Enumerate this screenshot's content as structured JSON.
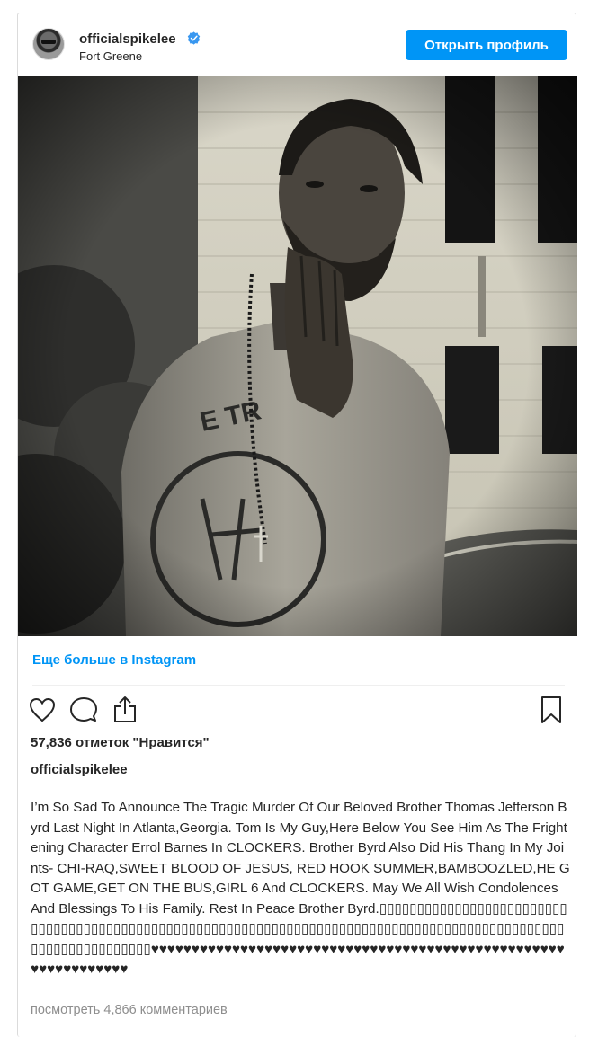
{
  "post": {
    "username": "officialspikelee",
    "location": "Fort Greene",
    "open_profile_label": "Открыть профиль",
    "more_link": "Еще больше в Instagram",
    "likes_text": "57,836 отметок \"Нравится\"",
    "caption_owner": "officialspikelee",
    "caption": "I’m So Sad To Announce The Tragic Murder Of Our Beloved Brother Thomas Jefferson Byrd Last Night In Atlanta,Georgia. Tom Is My Guy,Here Below You See Him As The Frightening Character Errol Barnes In CLOCKERS. Brother Byrd Also Did His Thang In My Joints- CHI-RAQ,SWEET BLOOD OF JESUS, RED HOOK SUMMER,BAMBOOZLED,HE GOT GAME,GET ON THE BUS,GIRL 6 And CLOCKERS. May We All Wish Condolences And Blessings To His Family. Rest In Peace Brother Byrd.▯▯▯▯▯▯▯▯▯▯▯▯▯▯▯▯▯▯▯▯▯▯▯▯▯▯▯▯▯▯▯▯▯▯▯▯▯▯▯▯▯▯▯▯▯▯▯▯▯▯▯▯▯▯▯▯▯▯▯▯▯▯▯▯▯▯▯▯▯▯▯▯▯▯▯▯▯▯▯▯▯▯▯▯▯▯▯▯▯▯▯▯▯▯▯▯▯▯▯▯▯▯▯▯▯▯▯▯▯▯▯▯♥♥♥♥♥♥♥♥♥♥♥♥♥♥♥♥♥♥♥♥♥♥♥♥♥♥♥♥♥♥♥♥♥♥♥♥♥♥♥♥♥♥♥♥♥♥♥♥♥♥♥♥♥♥♥♥♥♥♥♥♥♥♥",
    "comments_link": "посмотреть 4,866 комментариев"
  },
  "icons": {
    "verified": "verified-badge-icon",
    "like": "heart-outline-icon",
    "comment": "comment-bubble-icon",
    "share": "share-icon",
    "save": "bookmark-icon"
  },
  "colors": {
    "accent": "#0095f6",
    "text": "#262626",
    "muted": "#8e8e8e",
    "border": "#dbdbdb"
  }
}
